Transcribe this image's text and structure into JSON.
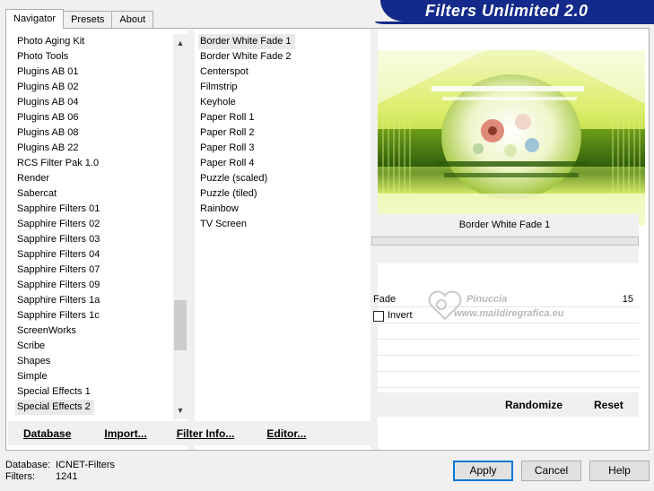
{
  "tabs": [
    {
      "label": "Navigator"
    },
    {
      "label": "Presets"
    },
    {
      "label": "About"
    }
  ],
  "banner_title": "Filters Unlimited 2.0",
  "categories": [
    "Photo Aging Kit",
    "Photo Tools",
    "Plugins AB 01",
    "Plugins AB 02",
    "Plugins AB 04",
    "Plugins AB 06",
    "Plugins AB 08",
    "Plugins AB 22",
    "RCS Filter Pak 1.0",
    "Render",
    "Sabercat",
    "Sapphire Filters 01",
    "Sapphire Filters 02",
    "Sapphire Filters 03",
    "Sapphire Filters 04",
    "Sapphire Filters 07",
    "Sapphire Filters 09",
    "Sapphire Filters 1a",
    "Sapphire Filters 1c",
    "ScreenWorks",
    "Scribe",
    "Shapes",
    "Simple",
    "Special Effects 1",
    "Special Effects 2"
  ],
  "selected_category": "Special Effects 2",
  "filters": [
    "Border White Fade 1",
    "Border White Fade 2",
    "Centerspot",
    "Filmstrip",
    "Keyhole",
    "Paper Roll 1",
    "Paper Roll 2",
    "Paper Roll 3",
    "Paper Roll 4",
    "Puzzle (scaled)",
    "Puzzle (tiled)",
    "Rainbow",
    "TV Screen"
  ],
  "selected_filter": "Border White Fade 1",
  "left_buttons": {
    "database": "Database",
    "import": "Import...",
    "filter_info": "Filter Info...",
    "editor": "Editor..."
  },
  "right_buttons": {
    "randomize": "Randomize",
    "reset": "Reset"
  },
  "current_filter_title": "Border White Fade 1",
  "params": {
    "fade_label": "Fade",
    "fade_value": "15",
    "invert_label": "Invert",
    "invert_checked": false
  },
  "watermark": {
    "line1": "Pinuccia",
    "line2": "www.maildiregrafica.eu"
  },
  "status": {
    "database_key": "Database:",
    "database_value": "ICNET-Filters",
    "filters_key": "Filters:",
    "filters_value": "1241"
  },
  "dialog_buttons": {
    "apply": "Apply",
    "cancel": "Cancel",
    "help": "Help"
  },
  "colors": {
    "banner": "#142a8a",
    "preview_light": "#f7fbd4",
    "preview_mid": "#a9cf2c",
    "preview_dark": "#4c7d16"
  }
}
